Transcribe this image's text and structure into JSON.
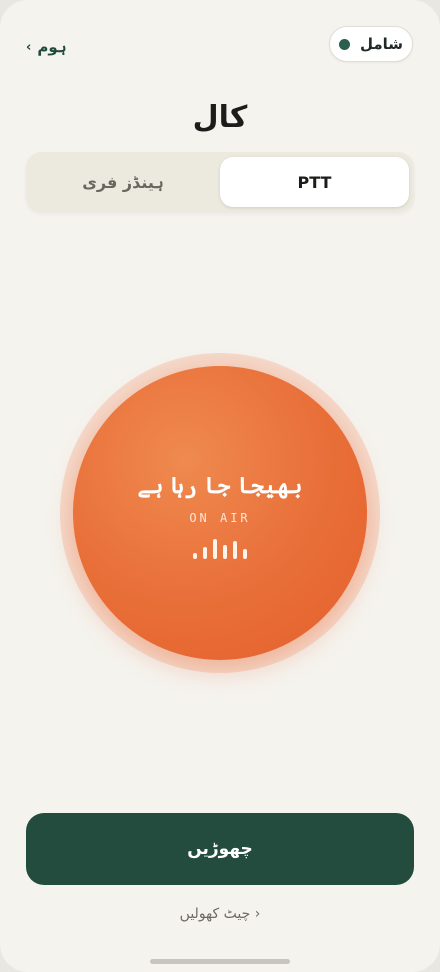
{
  "header": {
    "back_label": "ہوم",
    "back_icon": "chevron-left-icon",
    "status_label": "شامل",
    "status_color": "#2a5f4b"
  },
  "title": "کال",
  "mode_tabs": [
    {
      "label": "PTT",
      "selected": true
    },
    {
      "label": "ہینڈز فری",
      "selected": false
    }
  ],
  "ptt": {
    "status_text": "بھیجا جا رہا ہے",
    "on_air_label": "ON AIR",
    "accent_color": "#e9703a"
  },
  "leave_label": "چھوڑیں",
  "open_chat_label": "چیٹ کھولیں",
  "colors": {
    "background": "#f5f3ee",
    "primary_dark": "#234c3e",
    "accent": "#e9703a"
  }
}
